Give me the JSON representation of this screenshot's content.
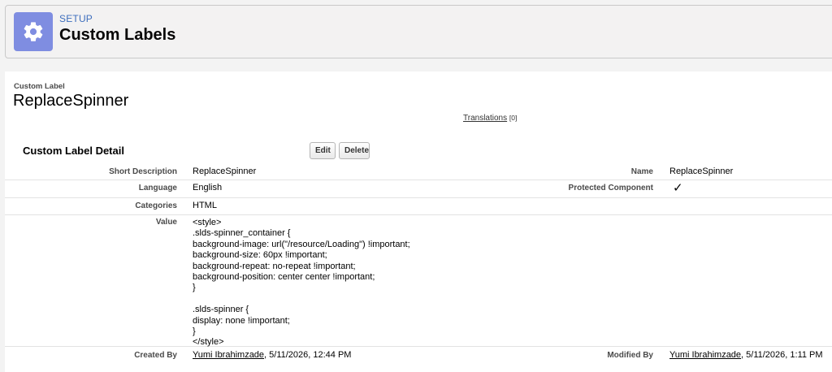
{
  "header": {
    "setup_label": "SETUP",
    "title": "Custom Labels",
    "icon": "gear-icon"
  },
  "record": {
    "type_label": "Custom Label",
    "name": "ReplaceSpinner",
    "translations_link": "Translations",
    "translations_count": "[0]"
  },
  "detail": {
    "title": "Custom Label Detail",
    "edit_label": "Edit",
    "delete_label": "Delete",
    "short_description_label": "Short Description",
    "short_description": "ReplaceSpinner",
    "name_label": "Name",
    "name": "ReplaceSpinner",
    "language_label": "Language",
    "language": "English",
    "protected_label": "Protected Component",
    "protected_value": "✓",
    "categories_label": "Categories",
    "categories": "HTML",
    "value_label": "Value",
    "value": "<style>\n.slds-spinner_container {\nbackground-image: url(\"/resource/Loading\") !important;\nbackground-size: 60px !important;\nbackground-repeat: no-repeat !important;\nbackground-position: center center !important;\n}\n\n.slds-spinner {\ndisplay: none !important;\n}\n</style>",
    "created_by_label": "Created By",
    "created_by_user": "Yumi Ibrahimzade",
    "created_by_date": ", 5/11/2026, 12:44 PM",
    "modified_by_label": "Modified By",
    "modified_by_user": "Yumi Ibrahimzade",
    "modified_by_date": ", 5/11/2026, 1:11 PM"
  }
}
